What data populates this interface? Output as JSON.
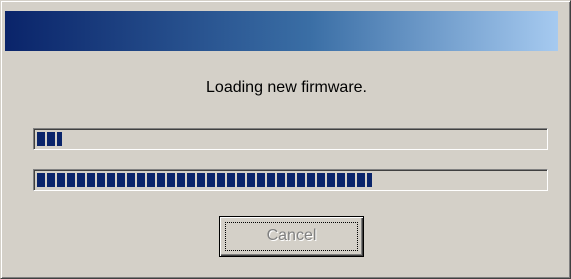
{
  "dialog": {
    "message": "Loading new firmware.",
    "progress_bars": [
      {
        "name": "progress-bar-1",
        "fraction": 0.05
      },
      {
        "name": "progress-bar-2",
        "fraction": 0.66
      }
    ],
    "cancel_label": "Cancel",
    "cancel_disabled": true
  },
  "colors": {
    "title_gradient_start": "#0a246a",
    "title_gradient_end": "#a6caf0",
    "dialog_background": "#d4d0c8",
    "progress_fill": "#0a246a"
  }
}
